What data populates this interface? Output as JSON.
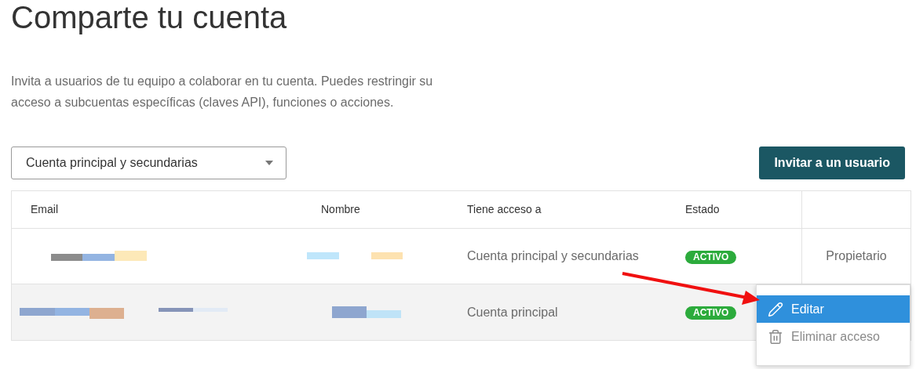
{
  "title": "Comparte tu cuenta",
  "description": "Invita a usuarios de tu equipo a colaborar en tu cuenta. Puedes restringir su acceso a subcuentas específicas (claves API), funciones o acciones.",
  "filter": {
    "value": "Cuenta principal y secundarias"
  },
  "invite_button": "Invitar a un usuario",
  "table": {
    "columns": [
      "Email",
      "Nombre",
      "Tiene acceso a",
      "Estado"
    ],
    "rows": [
      {
        "email": {
          "kind": "redacted"
        },
        "name": {
          "kind": "redacted"
        },
        "access": "Cuenta principal y secundarias",
        "status": "ACTIVO",
        "role": "Propietario",
        "selected": false
      },
      {
        "email": {
          "kind": "redacted"
        },
        "name": {
          "kind": "redacted"
        },
        "access": "Cuenta principal",
        "status": "ACTIVO",
        "selected": true
      }
    ]
  },
  "menu": {
    "items": [
      {
        "label": "Editar",
        "kind": "edit",
        "selected": true
      },
      {
        "label": "Eliminar acceso",
        "kind": "delete",
        "selected": false
      }
    ]
  },
  "annotation": {
    "kind": "arrow"
  }
}
